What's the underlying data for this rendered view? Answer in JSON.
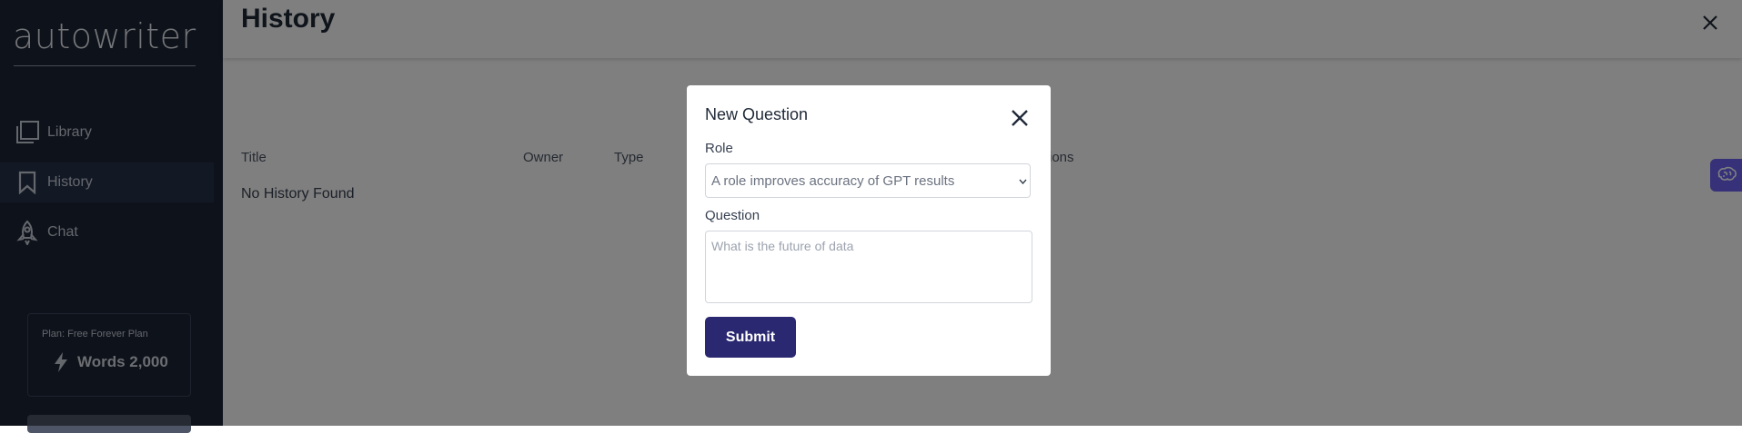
{
  "app": {
    "logo": "autowriter"
  },
  "sidebar": {
    "items": [
      {
        "label": "Library",
        "icon": "library-icon",
        "active": false
      },
      {
        "label": "History",
        "icon": "bookmark-icon",
        "active": true
      },
      {
        "label": "Chat",
        "icon": "rocket-icon",
        "active": false
      }
    ],
    "plan": {
      "label": "Plan: Free Forever Plan",
      "words": "Words 2,000"
    }
  },
  "main": {
    "title": "History",
    "table": {
      "headers": [
        "Title",
        "Owner",
        "Type",
        "ions"
      ],
      "empty_message": "No History Found"
    }
  },
  "modal": {
    "title": "New Question",
    "role_label": "Role",
    "role_selected": "A role improves accuracy of GPT results",
    "question_label": "Question",
    "question_placeholder": "What is the future of data",
    "question_value": "",
    "submit_label": "Submit"
  },
  "colors": {
    "sidebar_bg": "#1c2536",
    "submit_bg": "#2a2870",
    "side_tab_bg": "#6d63f2",
    "overlay": "rgba(0,0,0,0.5)"
  }
}
